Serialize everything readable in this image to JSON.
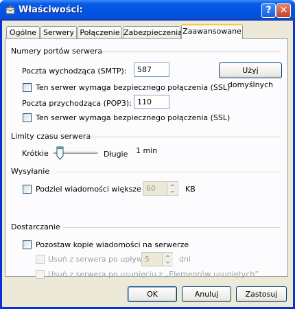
{
  "window": {
    "title": "Właściwości:",
    "help_icon": "help-icon",
    "close_icon": "close-icon"
  },
  "tabs": [
    {
      "label": "Ogólne",
      "active": false
    },
    {
      "label": "Serwery",
      "active": false
    },
    {
      "label": "Połączenie",
      "active": false
    },
    {
      "label": "Zabezpieczenia",
      "active": false
    },
    {
      "label": "Zaawansowane",
      "active": true
    }
  ],
  "ports": {
    "heading": "Numery portów serwera",
    "smtp_label": "Poczta wychodząca (SMTP):",
    "smtp_value": "587",
    "defaults_button": "Użyj domyślnych",
    "smtp_ssl_label": "Ten serwer wymaga bezpiecznego połączenia (SSL)",
    "smtp_ssl_checked": false,
    "pop3_label": "Poczta przychodząca (POP3):",
    "pop3_value": "110",
    "pop3_ssl_label": "Ten serwer wymaga bezpiecznego połączenia (SSL)",
    "pop3_ssl_checked": false
  },
  "timeouts": {
    "heading": "Limity czasu serwera",
    "short_label": "Krótkie",
    "long_label": "Długie",
    "value_text": "1 min",
    "slider_position": 0.1
  },
  "sending": {
    "heading": "Wysyłanie",
    "split_label": "Podziel wiadomości większe niż",
    "split_checked": false,
    "split_value": "60",
    "split_unit": "KB"
  },
  "delivery": {
    "heading": "Dostarczanie",
    "keep_copy_label": "Pozostaw kopie wiadomości na serwerze",
    "keep_copy_checked": false,
    "remove_after_label": "Usuń z serwera po upływie",
    "remove_after_value": "5",
    "remove_after_unit": "dni",
    "remove_deleted_label": "Usuń z serwera po usunięciu z „Elementów usuniętych”"
  },
  "footer": {
    "ok": "OK",
    "cancel": "Anuluj",
    "apply": "Zastosuj"
  },
  "colors": {
    "accent": "#0054e3",
    "tab_highlight": "#ffc73c",
    "group_line": "#d0d0bf"
  }
}
